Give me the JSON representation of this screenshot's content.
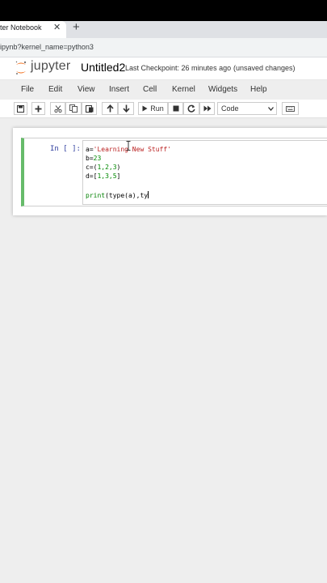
{
  "browser": {
    "tab_title": "ter Notebook",
    "tab_close": "✕",
    "new_tab": "+",
    "url": "ipynb?kernel_name=python3"
  },
  "header": {
    "logo_text": "jupyter",
    "notebook_title": "Untitled2",
    "checkpoint": "Last Checkpoint: 26 minutes ago",
    "unsaved": "(unsaved changes)"
  },
  "menu": {
    "items": [
      "File",
      "Edit",
      "View",
      "Insert",
      "Cell",
      "Kernel",
      "Widgets",
      "Help"
    ]
  },
  "toolbar": {
    "run_label": "Run",
    "cell_type": "Code",
    "icons": [
      "save-icon",
      "plus-icon",
      "cut-icon",
      "copy-icon",
      "paste-icon",
      "arrow-up-icon",
      "arrow-down-icon",
      "run-icon",
      "stop-icon",
      "restart-icon",
      "fast-forward-icon",
      "keyboard-icon"
    ]
  },
  "cell": {
    "prompt": "In [ ]:",
    "lines": [
      {
        "pre": "a=",
        "str": "'Learning New Stuff'"
      },
      {
        "pre": "b=",
        "num": "23"
      },
      {
        "pre": "c=(",
        "nums": "1,2,3",
        "post": ")"
      },
      {
        "pre": "d=[",
        "nums": "1,3,5",
        "post": "]"
      },
      {
        "fn": "print",
        "rest": "(type(a),ty"
      }
    ]
  },
  "colors": {
    "cell_selected_border": "#66bb6a",
    "prompt": "#303f9f",
    "string": "#ba2121",
    "number": "#008800"
  }
}
